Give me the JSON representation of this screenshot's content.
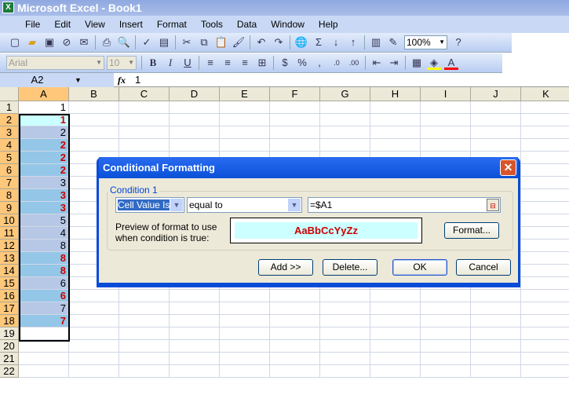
{
  "window": {
    "title": "Microsoft Excel - Book1"
  },
  "menu": [
    "File",
    "Edit",
    "View",
    "Insert",
    "Format",
    "Tools",
    "Data",
    "Window",
    "Help"
  ],
  "toolbar": {
    "zoom": "100%",
    "font": "Arial",
    "size": "10"
  },
  "formula_bar": {
    "name_box": "A2",
    "fx": "fx",
    "value": "1"
  },
  "columns": [
    "A",
    "B",
    "C",
    "D",
    "E",
    "F",
    "G",
    "H",
    "I",
    "J",
    "K"
  ],
  "rows": [
    "1",
    "2",
    "3",
    "4",
    "5",
    "6",
    "7",
    "8",
    "9",
    "10",
    "11",
    "12",
    "13",
    "14",
    "15",
    "16",
    "17",
    "18",
    "19",
    "20",
    "21",
    "22"
  ],
  "column_a": [
    "1",
    "1",
    "2",
    "2",
    "2",
    "2",
    "3",
    "3",
    "3",
    "5",
    "4",
    "8",
    "8",
    "8",
    "6",
    "6",
    "7",
    "7"
  ],
  "highlighted_rows": [
    2,
    4,
    5,
    6,
    8,
    9,
    13,
    14,
    16,
    18
  ],
  "colors": {
    "match": "#cc0000",
    "match_bg": "#94c6e8",
    "other_bg": "#b6c8e6",
    "active_bg": "#ccffff"
  },
  "dialog": {
    "title": "Conditional Formatting",
    "group_label": "Condition 1",
    "type": "Cell Value Is",
    "operator": "equal to",
    "formula": "=$A1",
    "preview_label_1": "Preview of format to use",
    "preview_label_2": "when condition is true:",
    "preview_sample": "AaBbCcYyZz",
    "format_btn": "Format...",
    "add_btn": "Add >>",
    "delete_btn": "Delete...",
    "ok_btn": "OK",
    "cancel_btn": "Cancel"
  }
}
